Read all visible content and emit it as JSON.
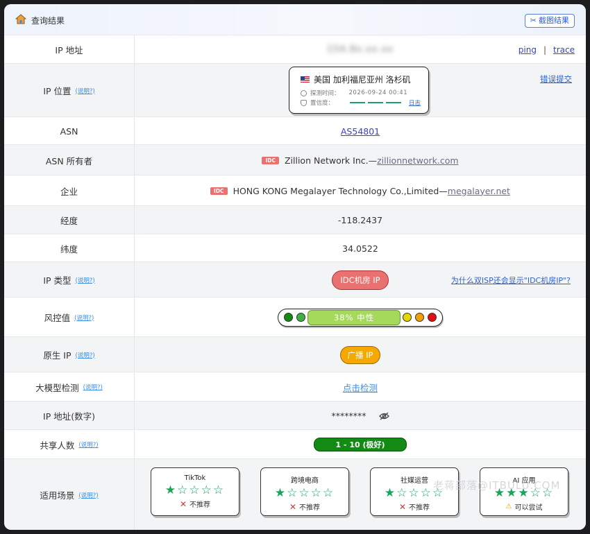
{
  "header": {
    "title": "查询结果",
    "screenshot_button": "截图结果"
  },
  "ip_row": {
    "label": "IP 地址",
    "value": "154.8x.xx.xx",
    "ping": "ping",
    "separator": "|",
    "trace": "trace"
  },
  "location_row": {
    "label": "IP 位置",
    "help": "(说明?)",
    "location": "美国 加利福尼亚州 洛杉矶",
    "probe_label": "探测时间：",
    "probe_time": "2026-09-24 00:41",
    "confidence_label": "置信度：",
    "log_link": "日志",
    "error_link": "错误提交"
  },
  "asn_row": {
    "label": "ASN",
    "value": "AS54801"
  },
  "asn_owner_row": {
    "label": "ASN 所有者",
    "tag": "IDC",
    "name": "Zillion Network Inc.—",
    "domain": "zillionnetwork.com"
  },
  "company_row": {
    "label": "企业",
    "tag": "IDC",
    "name": "HONG KONG Megalayer Technology Co.,Limited—",
    "domain": "megalayer.net"
  },
  "longitude_row": {
    "label": "经度",
    "value": "-118.2437"
  },
  "latitude_row": {
    "label": "纬度",
    "value": "34.0522"
  },
  "ip_type_row": {
    "label": "IP 类型",
    "help": "(说明?)",
    "value": "IDC机房 IP",
    "side_link": "为什么双ISP还会显示\"IDC机房IP\"?"
  },
  "risk_row": {
    "label": "风控值",
    "help": "(说明?)",
    "value": "38%  中性",
    "percent": 38,
    "colors": [
      "#138a13",
      "#3cb043",
      "#e5d600",
      "#f0a000",
      "#e01010"
    ]
  },
  "native_row": {
    "label": "原生 IP",
    "help": "(说明?)",
    "value": "广播 IP"
  },
  "llm_row": {
    "label": "大模型检测",
    "help": "(说明?)",
    "link": "点击检测"
  },
  "ip_numeric_row": {
    "label": "IP 地址(数字)",
    "value": "********",
    "icon": "eye-off-icon"
  },
  "share_row": {
    "label": "共享人数",
    "help": "(说明?)",
    "value": "1 - 10 (极好)"
  },
  "scenario_row": {
    "label": "适用场景",
    "help": "(说明?)",
    "cards": [
      {
        "title": "TikTok",
        "stars": "★☆☆☆☆",
        "rating": 1,
        "verdict": "不推荐",
        "icon": "x-icon"
      },
      {
        "title": "跨境电商",
        "stars": "★☆☆☆☆",
        "rating": 1,
        "verdict": "不推荐",
        "icon": "x-icon"
      },
      {
        "title": "社媒运营",
        "stars": "★☆☆☆☆",
        "rating": 1,
        "verdict": "不推荐",
        "icon": "x-icon"
      },
      {
        "title": "AI 应用",
        "stars": "★★★☆☆",
        "rating": 3,
        "verdict": "可以尝试",
        "icon": "warning-icon"
      }
    ]
  },
  "watermark": "老蒋部落@ITBULU.COM"
}
